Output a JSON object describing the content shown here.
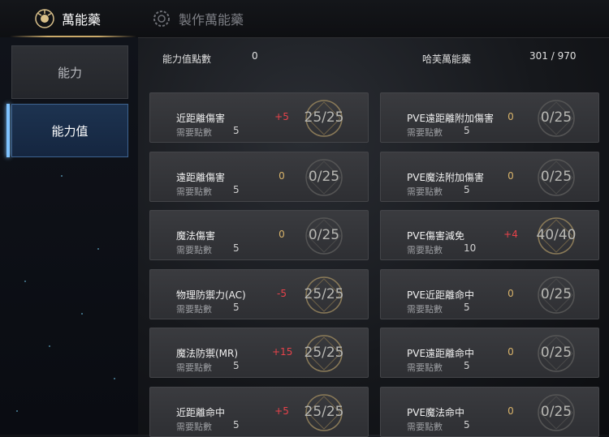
{
  "tabs": [
    {
      "label": "萬能藥",
      "active": true,
      "icon": "elixir-icon"
    },
    {
      "label": "製作萬能藥",
      "active": false,
      "icon": "craft-gear-icon"
    }
  ],
  "sidebar": {
    "items": [
      {
        "label": "能力",
        "active": false
      },
      {
        "label": "能力值",
        "active": true
      }
    ]
  },
  "header": {
    "points_label": "能力值點數",
    "points_value": "0",
    "elixir_label": "哈芙萬能藥",
    "elixir_value": "301 / 970"
  },
  "need_label": "需要點數",
  "colors": {
    "accent_gold": "#c9a96a",
    "bonus_red": "#e8424a",
    "bonus_gold": "#d9b36a",
    "active_blue": "#7fc3ff"
  },
  "stats_left": [
    {
      "name": "近距離傷害",
      "bonus": "+5",
      "need": "5",
      "level": "25/25",
      "progress": 1.0
    },
    {
      "name": "遠距離傷害",
      "bonus": "0",
      "need": "5",
      "level": "0/25",
      "progress": 0.0
    },
    {
      "name": "魔法傷害",
      "bonus": "0",
      "need": "5",
      "level": "0/25",
      "progress": 0.0
    },
    {
      "name": "物理防禦力(AC)",
      "bonus": "-5",
      "need": "5",
      "level": "25/25",
      "progress": 1.0
    },
    {
      "name": "魔法防禦(MR)",
      "bonus": "+15",
      "need": "5",
      "level": "25/25",
      "progress": 1.0
    },
    {
      "name": "近距離命中",
      "bonus": "+5",
      "need": "5",
      "level": "25/25",
      "progress": 1.0
    }
  ],
  "stats_right": [
    {
      "name": "PVE遠距離附加傷害",
      "bonus": "0",
      "need": "5",
      "level": "0/25",
      "progress": 0.0
    },
    {
      "name": "PVE魔法附加傷害",
      "bonus": "0",
      "need": "5",
      "level": "0/25",
      "progress": 0.0
    },
    {
      "name": "PVE傷害減免",
      "bonus": "+4",
      "need": "10",
      "level": "40/40",
      "progress": 1.0
    },
    {
      "name": "PVE近距離命中",
      "bonus": "0",
      "need": "5",
      "level": "0/25",
      "progress": 0.0
    },
    {
      "name": "PVE遠距離命中",
      "bonus": "0",
      "need": "5",
      "level": "0/25",
      "progress": 0.0
    },
    {
      "name": "PVE魔法命中",
      "bonus": "0",
      "need": "5",
      "level": "0/25",
      "progress": 0.0
    }
  ]
}
